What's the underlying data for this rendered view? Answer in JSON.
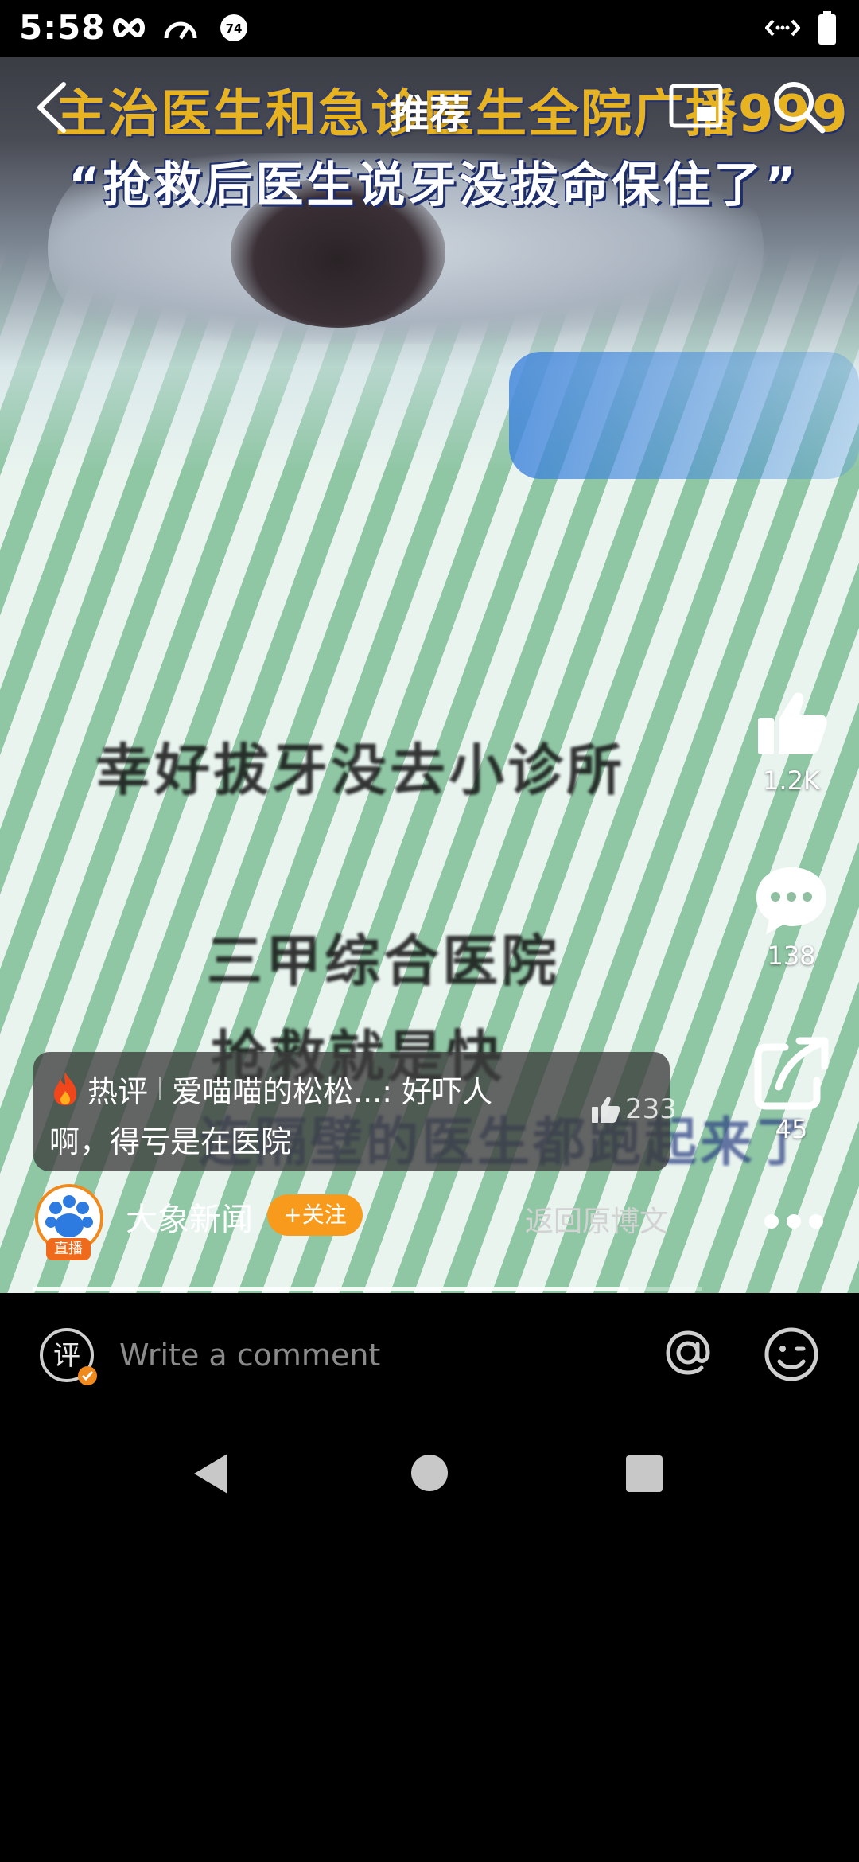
{
  "status_bar": {
    "time": "5:58",
    "battery_badge": "74"
  },
  "header": {
    "tab_title": "推荐"
  },
  "video": {
    "title_line1": "主治医生和急诊医生全院广播999",
    "title_line2": "“抢救后医生说牙没拔命保住了”",
    "subtitle1": "幸好拔牙没去小诊所",
    "subtitle2": "三甲综合医院",
    "subtitle3": "抢救就是快",
    "subtitle4": "连隔壁的医生都跑起来了"
  },
  "right_rail": {
    "likes": "1.2K",
    "comments": "138",
    "shares": "45"
  },
  "hot_comment": {
    "label": "热评",
    "user": "爱喵喵的松松...",
    "text_line1": ": 好吓人",
    "text_line2": "啊，得亏是在医院",
    "likes": "233"
  },
  "author": {
    "live_badge": "直播",
    "name": "大象新闻",
    "follow_label": "+关注",
    "return_link": "返回原博文"
  },
  "playback": {
    "progress": 0.89
  },
  "comment_bar": {
    "review_icon_label": "评",
    "placeholder": "Write a comment"
  },
  "colors": {
    "accent_orange": "#f89b1c",
    "title_yellow": "#e8b321"
  },
  "icons": [
    "back-icon",
    "pip-icon",
    "search-icon",
    "thumb-up-icon",
    "comment-bubble-icon",
    "share-icon",
    "fire-icon",
    "more-icon",
    "at-icon",
    "emoji-icon"
  ]
}
